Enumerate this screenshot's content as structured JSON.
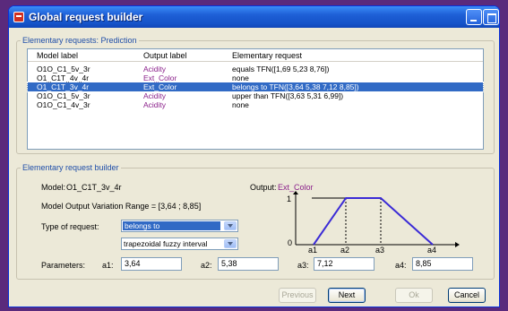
{
  "window": {
    "title": "Global request builder"
  },
  "requests_group": {
    "title": "Elementary requests: Prediction",
    "columns": [
      "Model label",
      "Output label",
      "Elementary request"
    ],
    "rows": [
      {
        "model": "O1O_C1_5v_3r",
        "output": "Acidity",
        "request": "equals TFN([1,69 5,23 8,76])",
        "selected": false
      },
      {
        "model": "O1_C1T_4v_4r",
        "output": "Ext_Color",
        "request": "none",
        "selected": false
      },
      {
        "model": "O1_C1T_3v_4r",
        "output": "Ext_Color",
        "request": "belongs to TFN([3,64 5,38 7,12 8,85])",
        "selected": true
      },
      {
        "model": "O1O_C1_5v_3r",
        "output": "Acidity",
        "request": "upper than TFN([3,63 5,31 6,99])",
        "selected": false
      },
      {
        "model": "O1O_C1_4v_3r",
        "output": "Acidity",
        "request": "none",
        "selected": false
      }
    ]
  },
  "builder_group": {
    "title": "Elementary request builder",
    "model_label": "Model:",
    "model_value": "O1_C1T_3v_4r",
    "output_label": "Output:",
    "output_value": "Ext_Color",
    "range_text": "Model Output Variation Range = [3,64 ; 8,85]",
    "type_label": "Type of request:",
    "type_value": "belongs to",
    "interval_value": "trapezoidal fuzzy interval",
    "parameters_label": "Parameters:",
    "params": [
      {
        "label": "a1:",
        "value": "3,64"
      },
      {
        "label": "a2:",
        "value": "5,38"
      },
      {
        "label": "a3:",
        "value": "7,12"
      },
      {
        "label": "a4:",
        "value": "8,85"
      }
    ]
  },
  "diagram": {
    "y_top": "1",
    "y_bottom": "0",
    "x_labels": [
      "a1",
      "a2",
      "a3",
      "a4"
    ],
    "line_color": "#3b2bd6"
  },
  "buttons": {
    "previous": "Previous",
    "next": "Next",
    "ok": "Ok",
    "cancel": "Cancel"
  }
}
